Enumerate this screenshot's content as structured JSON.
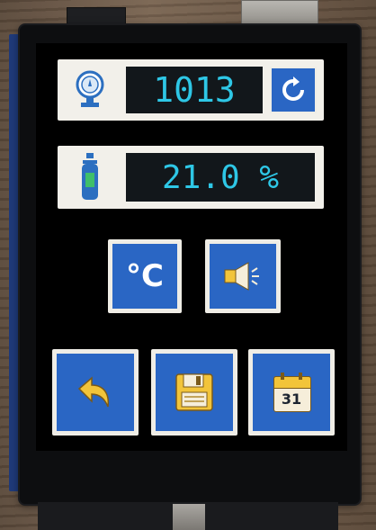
{
  "pressure": {
    "value": "1013",
    "gauge_icon": "pressure-gauge-icon",
    "refresh_icon": "refresh-icon"
  },
  "oxygen": {
    "value": "21.0 %",
    "cylinder_icon": "oxygen-cylinder-icon"
  },
  "controls": {
    "celsius_label": "°C",
    "speaker_icon": "speaker-icon",
    "back_icon": "back-arrow-icon",
    "save_icon": "floppy-disk-icon",
    "calendar_day": "31"
  },
  "colors": {
    "readout_text": "#2ec7e6",
    "button_blue": "#2a66c4",
    "icon_yellow": "#f2c43a"
  }
}
